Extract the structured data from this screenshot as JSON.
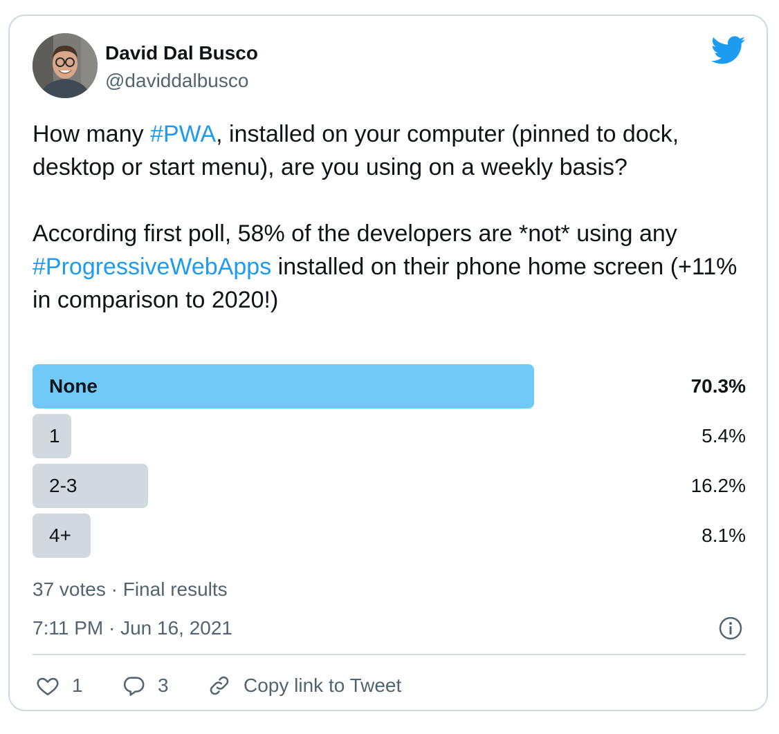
{
  "author": {
    "name": "David Dal Busco",
    "handle": "@daviddalbusco"
  },
  "icons": {
    "brand": "twitter-bird-icon",
    "info": "info-icon",
    "like": "heart-icon",
    "reply": "reply-bubble-icon",
    "copy_link": "link-icon"
  },
  "tweet": {
    "p1_before": "How many ",
    "p1_hashtag": "#PWA",
    "p1_after": ", installed on your computer (pinned to dock, desktop or start menu), are you using on a weekly basis?",
    "p2_before": "According first poll, 58% of the developers are *not* using any ",
    "p2_hashtag": "#ProgressiveWebApps",
    "p2_after": " installed on their phone home screen (+11% in comparison to 2020!)"
  },
  "poll": {
    "options": [
      {
        "label": "None",
        "percent_label": "70.3%",
        "percent": 70.3,
        "winner": true
      },
      {
        "label": "1",
        "percent_label": "5.4%",
        "percent": 5.4,
        "winner": false
      },
      {
        "label": "2-3",
        "percent_label": "16.2%",
        "percent": 16.2,
        "winner": false
      },
      {
        "label": "4+",
        "percent_label": "8.1%",
        "percent": 8.1,
        "winner": false
      }
    ],
    "summary": "37 votes · Final results"
  },
  "timestamp": "7:11 PM · Jun 16, 2021",
  "actions": {
    "likes": "1",
    "replies": "3",
    "copy_link_label": "Copy link to Tweet"
  },
  "colors": {
    "accent": "#1d9bf0",
    "winner_bar": "#71c9f8",
    "bar": "#cfd9de",
    "muted_text": "#536471"
  }
}
